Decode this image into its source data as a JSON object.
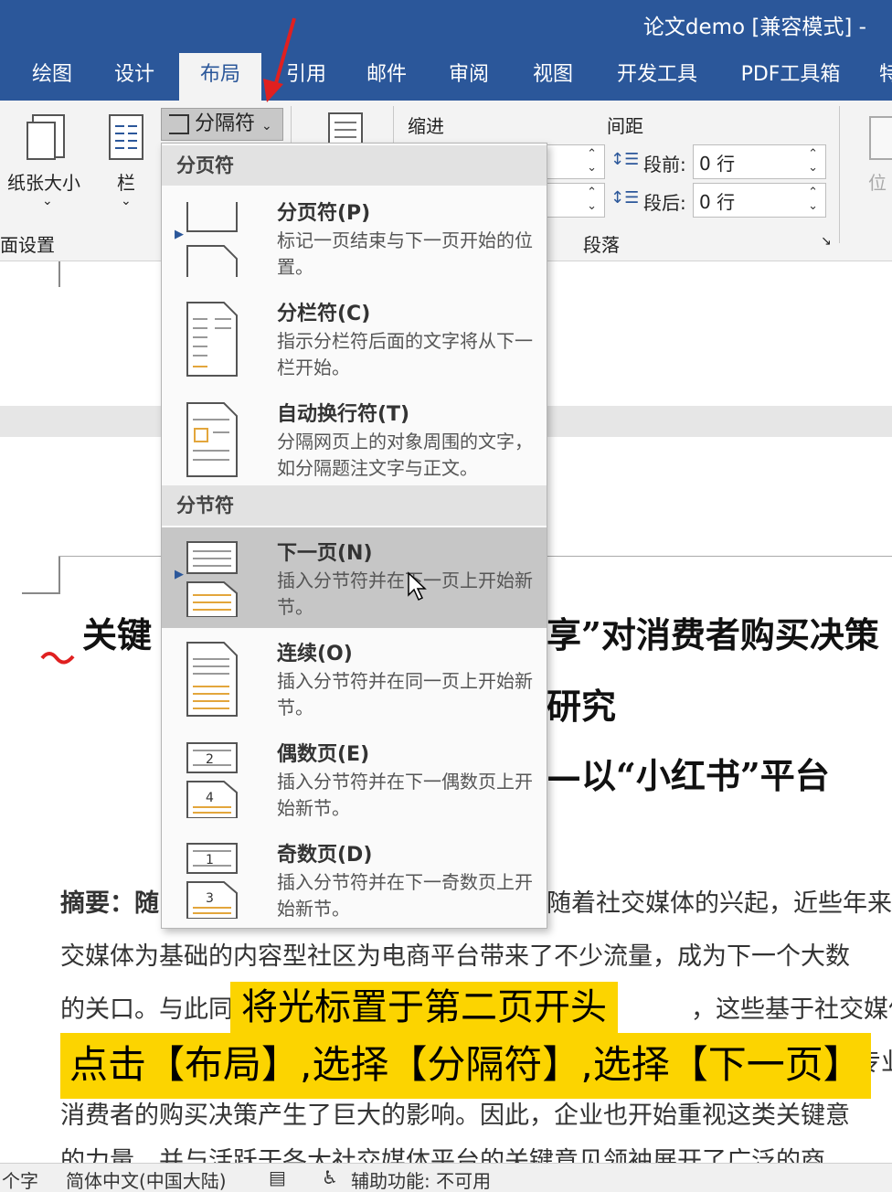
{
  "window": {
    "title": "论文demo [兼容模式] -"
  },
  "tabs": [
    {
      "label": "绘图"
    },
    {
      "label": "设计"
    },
    {
      "label": "布局"
    },
    {
      "label": "引用"
    },
    {
      "label": "邮件"
    },
    {
      "label": "审阅"
    },
    {
      "label": "视图"
    },
    {
      "label": "开发工具"
    },
    {
      "label": "PDF工具箱"
    },
    {
      "label": "特"
    }
  ],
  "ribbon": {
    "paper_size": "纸张大小",
    "columns": "栏",
    "page_setup": "页面设置",
    "breaks": "分隔符",
    "indent": "缩进",
    "spacing": "间距",
    "before_label": "段前:",
    "before_value": "0 行",
    "after_label": "段后:",
    "after_value": "0 行",
    "paragraph": "段落",
    "position": "位"
  },
  "menu": {
    "page_breaks_header": "分页符",
    "section_breaks_header": "分节符",
    "items": [
      {
        "title": "分页符(P)",
        "desc": "标记一页结束与下一页开始的位置。"
      },
      {
        "title": "分栏符(C)",
        "desc": "指示分栏符后面的文字将从下一栏开始。"
      },
      {
        "title": "自动换行符(T)",
        "desc": "分隔网页上的对象周围的文字，如分隔题注文字与正文。"
      },
      {
        "title": "下一页(N)",
        "desc": "插入分节符并在下一页上开始新节。"
      },
      {
        "title": "连续(O)",
        "desc": "插入分节符并在同一页上开始新节。"
      },
      {
        "title": "偶数页(E)",
        "desc": "插入分节符并在下一偶数页上开始新节。"
      },
      {
        "title": "奇数页(D)",
        "desc": "插入分节符并在下一奇数页上开始新节。"
      }
    ],
    "icon_numbers": {
      "even_top": "2",
      "even_bottom": "4",
      "odd_top": "1",
      "odd_bottom": "3"
    }
  },
  "document": {
    "title_line1_left": "关键",
    "title_line1_right": "享”对消费者购买决策",
    "title_line2_right": "研究",
    "title_line3_right": "—以“小红书”平台",
    "abstract_left": "摘要：随",
    "abstract_right": "随着社交媒体的兴起，近些年来",
    "line2": "交媒体为基础的内容型社区为电商平台带来了不少流量，成为下一个大数",
    "line3_left": "的关口。与此同",
    "line3_right": "，这些基于社交媒体",
    "line4_right": "的专业",
    "line5": "消费者的购买决策产生了巨大的影响。因此，企业也开始重视这类关键意",
    "line6": "的力量，并与活跃于各大社交媒体平台的关键意见领袖展开了广泛的商"
  },
  "caption": {
    "line1": "将光标置于第二页开头",
    "line2": "点击【布局】,选择【分隔符】,选择【下一页】"
  },
  "statusbar": {
    "word_count": "个字",
    "language": "简体中文(中国大陆)",
    "accessibility": "辅助功能: 不可用"
  },
  "colors": {
    "ribbon_blue": "#2b579a",
    "caption_yellow": "#fcd400",
    "arrow_red": "#e02020"
  }
}
